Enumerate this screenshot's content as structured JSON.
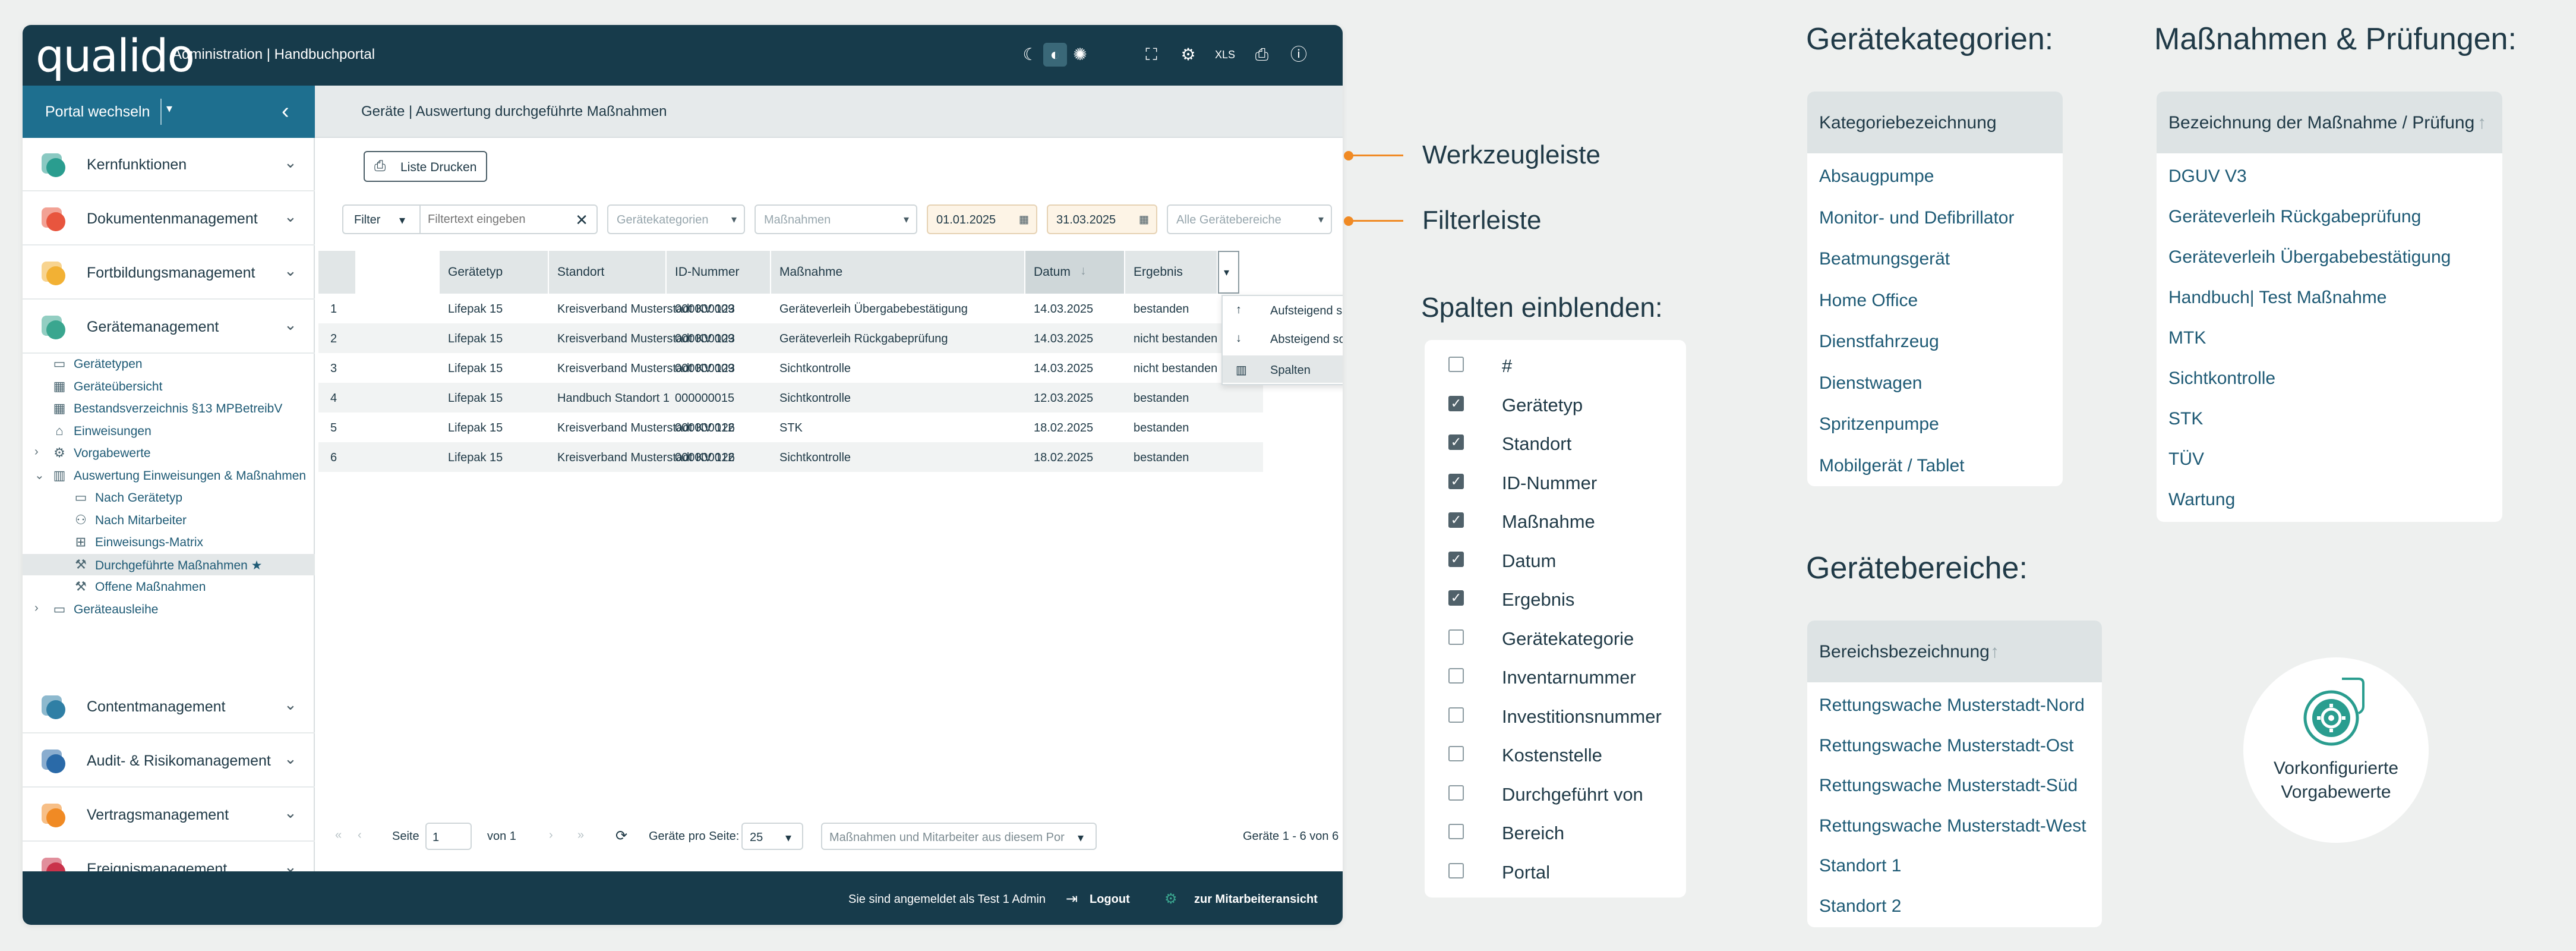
{
  "app": {
    "logo": "qualido",
    "title": "Administration | Handbuchportal",
    "portal_switch": "Portal wechseln",
    "breadcrumb": "Geräte | Auswertung durchgeführte Maßnahmen"
  },
  "topbar_icons": [
    "moon-icon",
    "contrast-icon",
    "sun-icon",
    "screenshot-icon",
    "gear-icon",
    "xlsx-icon",
    "printer-icon",
    "help-icon"
  ],
  "sidebar": {
    "modules_top": [
      {
        "label": "Kernfunktionen",
        "color": "#2a9d8f"
      },
      {
        "label": "Dokumentenmanagement",
        "color": "#e8553e"
      },
      {
        "label": "Fortbildungsmanagement",
        "color": "#f2b134"
      },
      {
        "label": "Gerätemanagement",
        "color": "#3aa68f"
      }
    ],
    "subitems": [
      {
        "label": "Gerätetypen",
        "icon": "monitor-icon"
      },
      {
        "label": "Geräteübersicht",
        "icon": "grid-icon"
      },
      {
        "label": "Bestandsverzeichnis §13 MPBetreibV",
        "icon": "grid-icon"
      },
      {
        "label": "Einweisungen",
        "icon": "graduation-icon"
      },
      {
        "label": "Vorgabewerte",
        "icon": "gear-icon"
      },
      {
        "label": "Auswertung Einweisungen & Maßnahmen",
        "icon": "chart-icon"
      },
      {
        "label": "Nach Gerätetyp",
        "icon": "monitor-icon"
      },
      {
        "label": "Nach Mitarbeiter",
        "icon": "users-icon"
      },
      {
        "label": "Einweisungs-Matrix",
        "icon": "table-icon"
      },
      {
        "label": "Durchgeführte Maßnahmen ★",
        "icon": "wrench-icon"
      },
      {
        "label": "Offene Maßnahmen",
        "icon": "wrench-icon"
      },
      {
        "label": "Geräteausleihe",
        "icon": "monitor-icon"
      }
    ],
    "modules_bottom": [
      {
        "label": "Contentmanagement",
        "color": "#2f7fa5"
      },
      {
        "label": "Audit- & Risikomanagement",
        "color": "#2a6aa8"
      },
      {
        "label": "Vertragsmanagement",
        "color": "#f08a24"
      },
      {
        "label": "Ereignismanagement",
        "color": "#c9334b"
      }
    ]
  },
  "toolbar": {
    "print_label": "Liste Drucken"
  },
  "filter": {
    "filter_btn": "Filter",
    "text_placeholder": "Filtertext eingeben",
    "categories_placeholder": "Gerätekategorien",
    "measures_placeholder": "Maßnahmen",
    "date_from": "01.01.2025",
    "date_to": "31.03.2025",
    "areas_placeholder": "Alle Gerätebereiche"
  },
  "table": {
    "headers": [
      "Gerätetyp",
      "Standort",
      "ID-Nummer",
      "Maßnahme",
      "Datum",
      "Ergebnis"
    ],
    "rows": [
      [
        "1",
        "Lifepak 15",
        "Kreisverband Musterstadt KV 123",
        "000000009",
        "Geräteverleih Übergabebestätigung",
        "14.03.2025",
        "bestanden"
      ],
      [
        "2",
        "Lifepak 15",
        "Kreisverband Musterstadt KV 123",
        "000000009",
        "Geräteverleih Rückgabeprüfung",
        "14.03.2025",
        "nicht bestanden"
      ],
      [
        "3",
        "Lifepak 15",
        "Kreisverband Musterstadt KV 123",
        "000000009",
        "Sichtkontrolle",
        "14.03.2025",
        "nicht bestanden"
      ],
      [
        "4",
        "Lifepak 15",
        "Handbuch Standort 1",
        "000000015",
        "Sichtkontrolle",
        "12.03.2025",
        "bestanden"
      ],
      [
        "5",
        "Lifepak 15",
        "Kreisverband Musterstadt KV 126",
        "000000012",
        "STK",
        "18.02.2025",
        "bestanden"
      ],
      [
        "6",
        "Lifepak 15",
        "Kreisverband Musterstadt KV 126",
        "000000012",
        "Sichtkontrolle",
        "18.02.2025",
        "bestanden"
      ]
    ]
  },
  "column_menu": {
    "asc": "Aufsteigend sortieren",
    "desc": "Absteigend sortieren",
    "columns": "Spalten"
  },
  "pager": {
    "page_label": "Seite",
    "page_value": "1",
    "of_label": "von 1",
    "per_page_label": "Geräte pro Seite:",
    "per_page_value": "25",
    "scope_select": "Maßnahmen und Mitarbeiter aus diesem Por",
    "summary": "Geräte 1 - 6 von 6"
  },
  "footer": {
    "logged_in": "Sie sind angemeldet als Test 1 Admin",
    "logout": "Logout",
    "employee_view": "zur Mitarbeiteransicht"
  },
  "annotations": {
    "toolbar": "Werkzeugleiste",
    "filterbar": "Filterleiste"
  },
  "columns_panel": {
    "title": "Spalten einblenden:",
    "items": [
      {
        "label": "#",
        "checked": false
      },
      {
        "label": "Gerätetyp",
        "checked": true
      },
      {
        "label": "Standort",
        "checked": true
      },
      {
        "label": "ID-Nummer",
        "checked": true
      },
      {
        "label": "Maßnahme",
        "checked": true
      },
      {
        "label": "Datum",
        "checked": true
      },
      {
        "label": "Ergebnis",
        "checked": true
      },
      {
        "label": "Gerätekategorie",
        "checked": false
      },
      {
        "label": "Inventarnummer",
        "checked": false
      },
      {
        "label": "Investitionsnummer",
        "checked": false
      },
      {
        "label": "Kostenstelle",
        "checked": false
      },
      {
        "label": "Durchgeführt von",
        "checked": false
      },
      {
        "label": "Bereich",
        "checked": false
      },
      {
        "label": "Portal",
        "checked": false
      }
    ]
  },
  "categories_panel": {
    "title": "Gerätekategorien:",
    "header": "Kategoriebezeichnung",
    "items": [
      "Absaugpumpe",
      "Monitor- und Defibrillator",
      "Beatmungsgerät",
      "Home Office",
      "Dienstfahrzeug",
      "Dienstwagen",
      "Spritzenpumpe",
      "Mobilgerät / Tablet"
    ]
  },
  "measures_panel": {
    "title": "Maßnahmen & Prüfungen:",
    "header": "Bezeichnung der Maßnahme / Prüfung",
    "items": [
      "DGUV V3",
      "Geräteverleih Rückgabeprüfung",
      "Geräteverleih Übergabebestätigung",
      "Handbuch| Test Maßnahme",
      "MTK",
      "Sichtkontrolle",
      "STK",
      "TÜV",
      "Wartung"
    ]
  },
  "areas_panel": {
    "title": "Gerätebereiche:",
    "header": "Bereichsbezeichnung",
    "items": [
      "Rettungswache Musterstadt-Nord",
      "Rettungswache Musterstadt-Ost",
      "Rettungswache Musterstadt-Süd",
      "Rettungswache Musterstadt-West",
      "Standort 1",
      "Standort 2"
    ]
  },
  "preset_badge": {
    "line1": "Vorkonfigurierte",
    "line2": "Vorgabewerte"
  }
}
